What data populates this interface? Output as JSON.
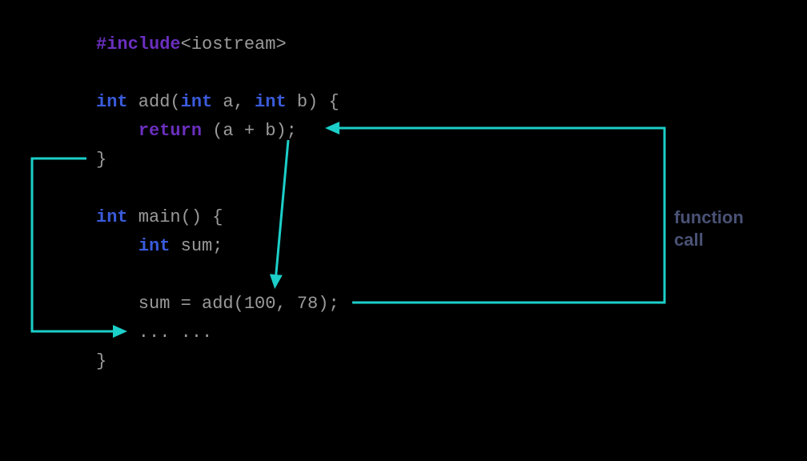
{
  "code": {
    "l1_include": "#include",
    "l1_rest": "<iostream>",
    "l3_int1": "int",
    "l3_mid": " add(",
    "l3_int2": "int",
    "l3_mid2": " a, ",
    "l3_int3": "int",
    "l3_end": " b) {",
    "l4_indent": "    ",
    "l4_return": "return",
    "l4_rest": " (a + b);",
    "l5": "}",
    "l7_int": "int",
    "l7_rest": " main() {",
    "l8_indent": "    ",
    "l8_int": "int",
    "l8_rest": " sum;",
    "l10": "    sum = add(100, 78);",
    "l11": "    ... ...",
    "l12": "}"
  },
  "label": {
    "line1": "function",
    "line2": "call"
  },
  "colors": {
    "arrow": "#1ccfc9",
    "purple": "#6b2fbf",
    "blue": "#3a5bdb",
    "gray": "#9a9a9a",
    "label": "#4a5275"
  }
}
